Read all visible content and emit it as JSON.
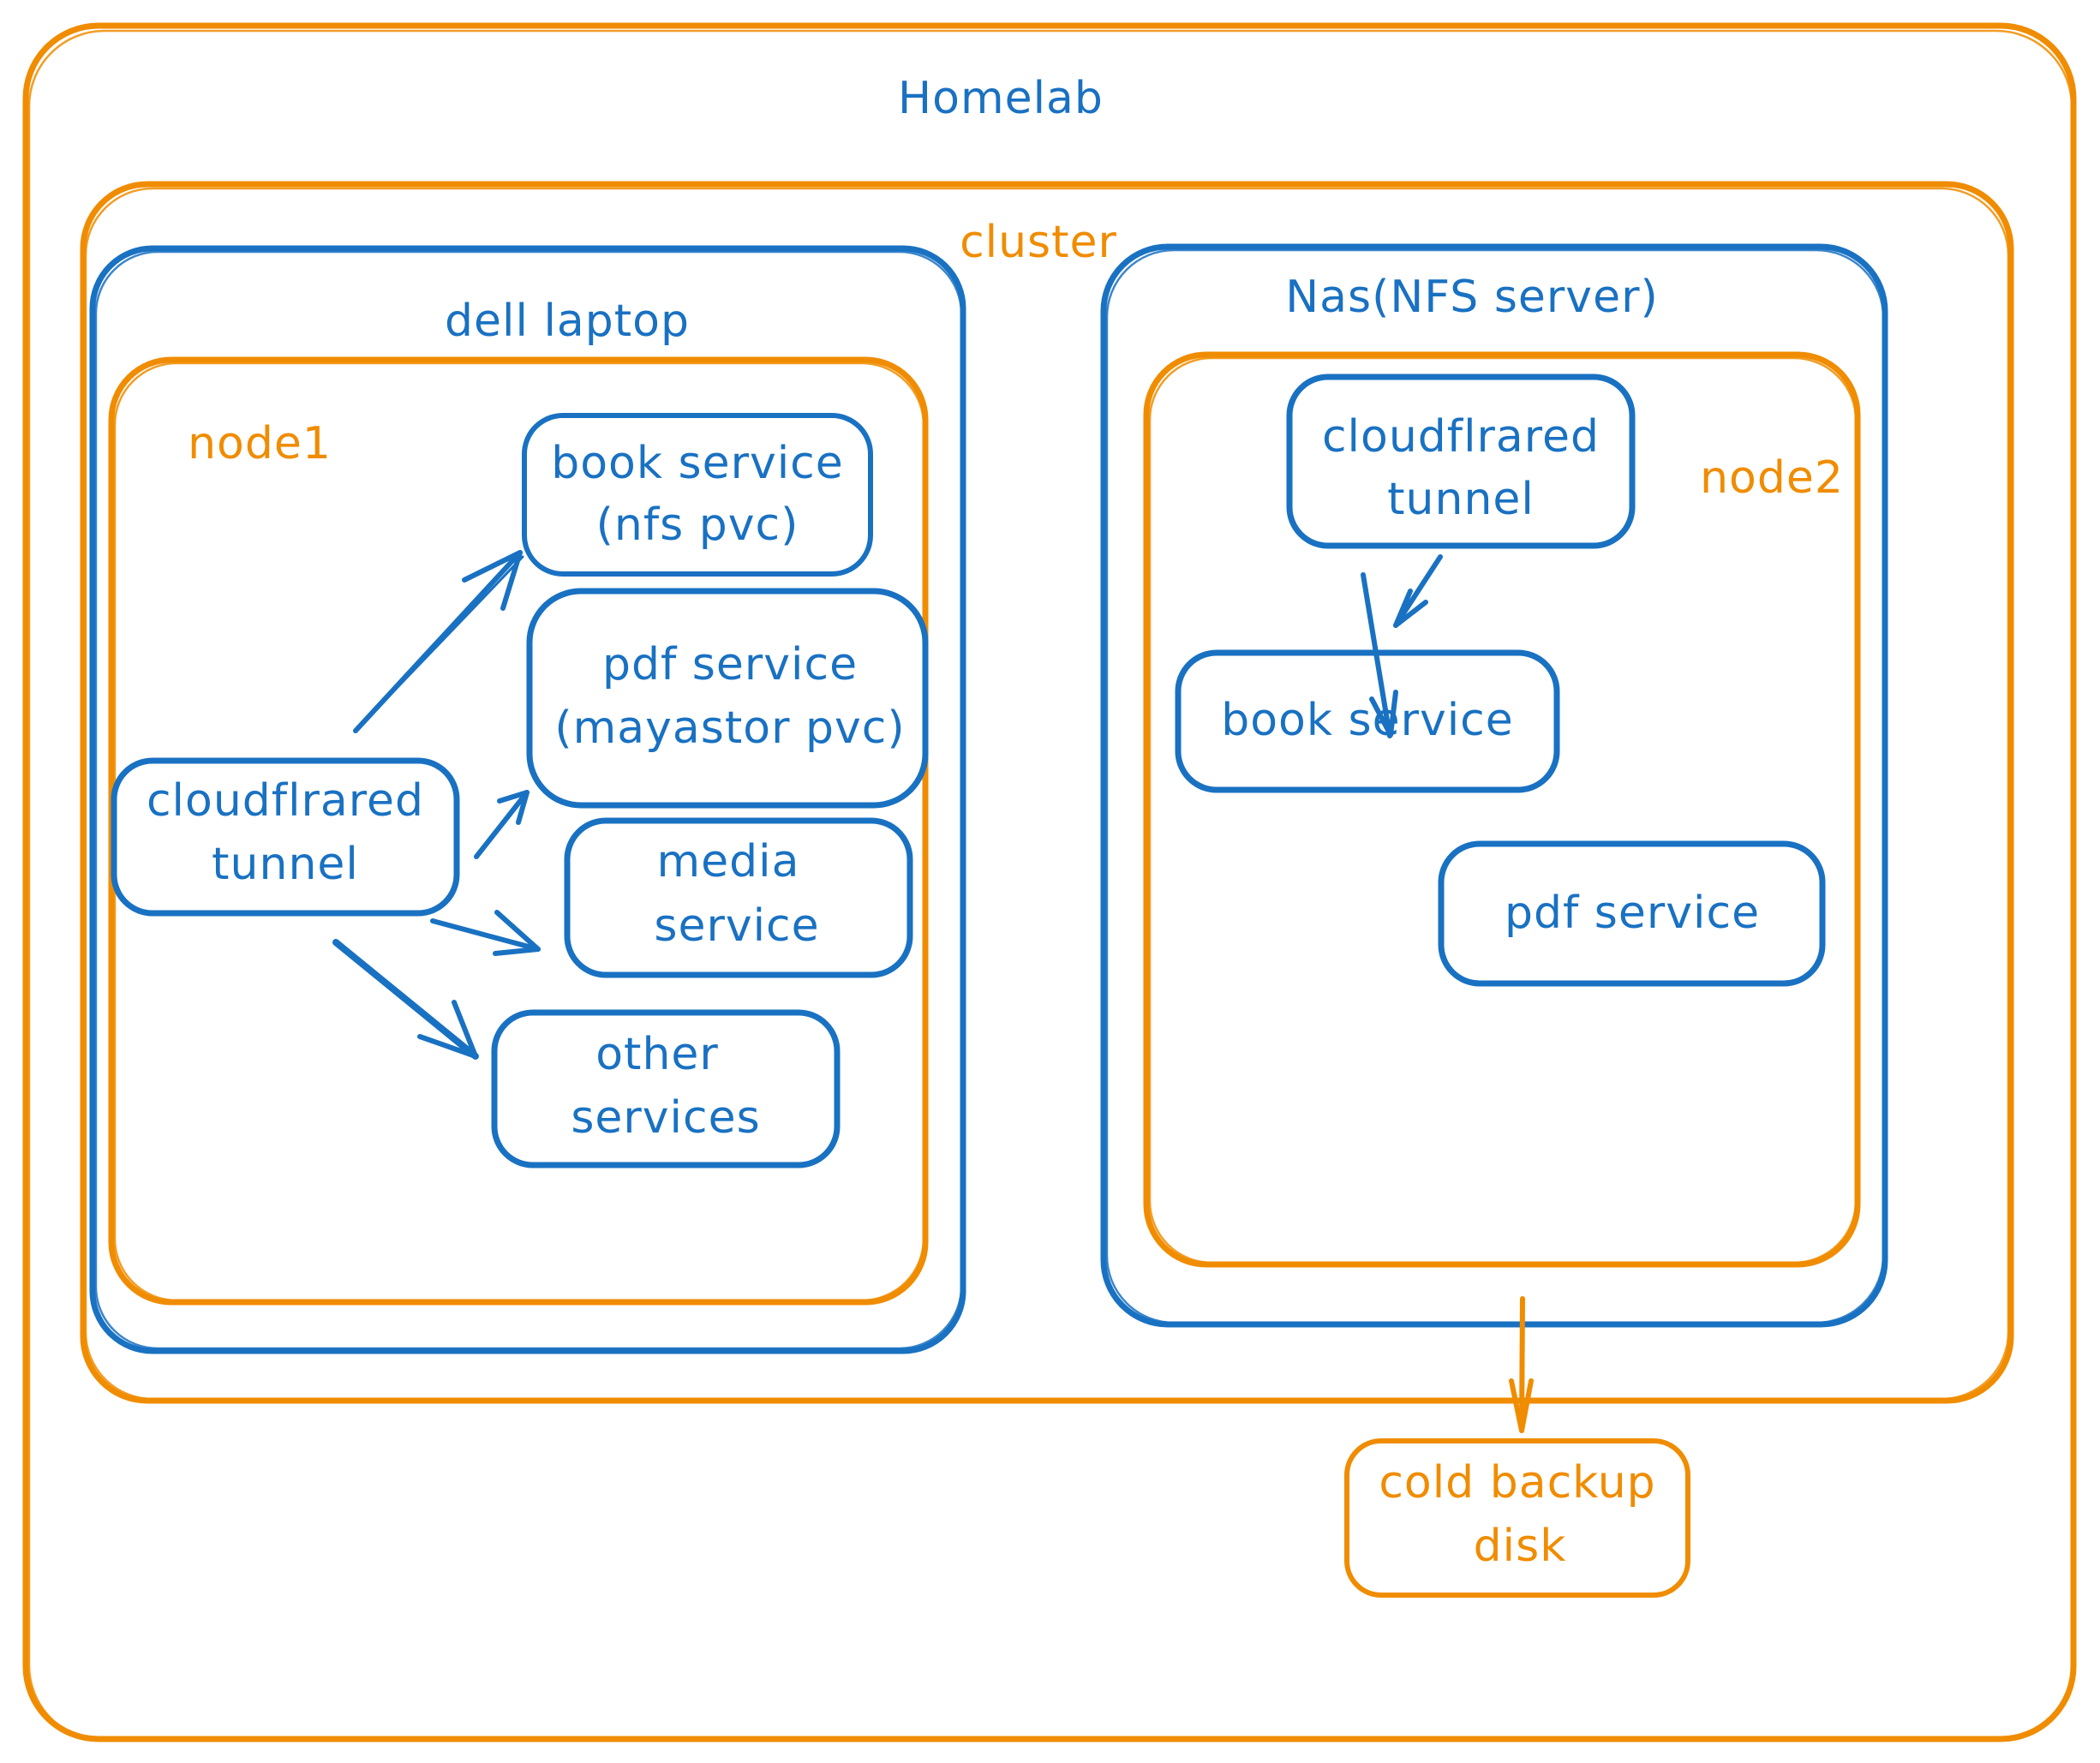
{
  "colors": {
    "orange": "#f08c00",
    "blue": "#1971c2",
    "background": "#ffffff"
  },
  "containers": {
    "homelab": {
      "label": "Homelab",
      "color": "orange",
      "label_color": "blue"
    },
    "cluster": {
      "label": "cluster",
      "color": "orange",
      "label_color": "orange"
    },
    "dell_laptop": {
      "label": "dell laptop",
      "color": "blue",
      "label_color": "blue"
    },
    "node1": {
      "label": "node1",
      "color": "orange",
      "label_color": "orange"
    },
    "nas": {
      "label": "Nas(NFS server)",
      "color": "blue",
      "label_color": "blue"
    },
    "node2": {
      "label": "node2",
      "color": "orange",
      "label_color": "orange"
    }
  },
  "nodes": {
    "node1_tunnel": {
      "lines": [
        "cloudflrared",
        "tunnel"
      ]
    },
    "node1_book_service": {
      "lines": [
        "book service",
        "(nfs pvc)"
      ]
    },
    "node1_pdf_service": {
      "lines": [
        "pdf service",
        "(mayastor pvc)"
      ]
    },
    "node1_media_service": {
      "lines": [
        "media",
        "service"
      ]
    },
    "node1_other_services": {
      "lines": [
        "other",
        "services"
      ]
    },
    "node2_tunnel": {
      "lines": [
        "cloudflrared",
        "tunnel"
      ]
    },
    "node2_book_service": {
      "lines": [
        "book service"
      ]
    },
    "node2_pdf_service": {
      "lines": [
        "pdf service"
      ]
    },
    "cold_backup_disk": {
      "lines": [
        "cold backup",
        "disk"
      ]
    }
  },
  "edges": [
    {
      "from": "node1_tunnel",
      "to": "node1_book_service",
      "color": "blue"
    },
    {
      "from": "node1_tunnel",
      "to": "node1_pdf_service",
      "color": "blue"
    },
    {
      "from": "node1_tunnel",
      "to": "node1_media_service",
      "color": "blue"
    },
    {
      "from": "node1_tunnel",
      "to": "node1_other_services",
      "color": "blue"
    },
    {
      "from": "node2_tunnel",
      "to": "node2_book_service",
      "color": "blue"
    },
    {
      "from": "node2_tunnel",
      "to": "node2_pdf_service",
      "color": "blue"
    },
    {
      "from": "nas",
      "to": "cold_backup_disk",
      "color": "orange"
    }
  ]
}
